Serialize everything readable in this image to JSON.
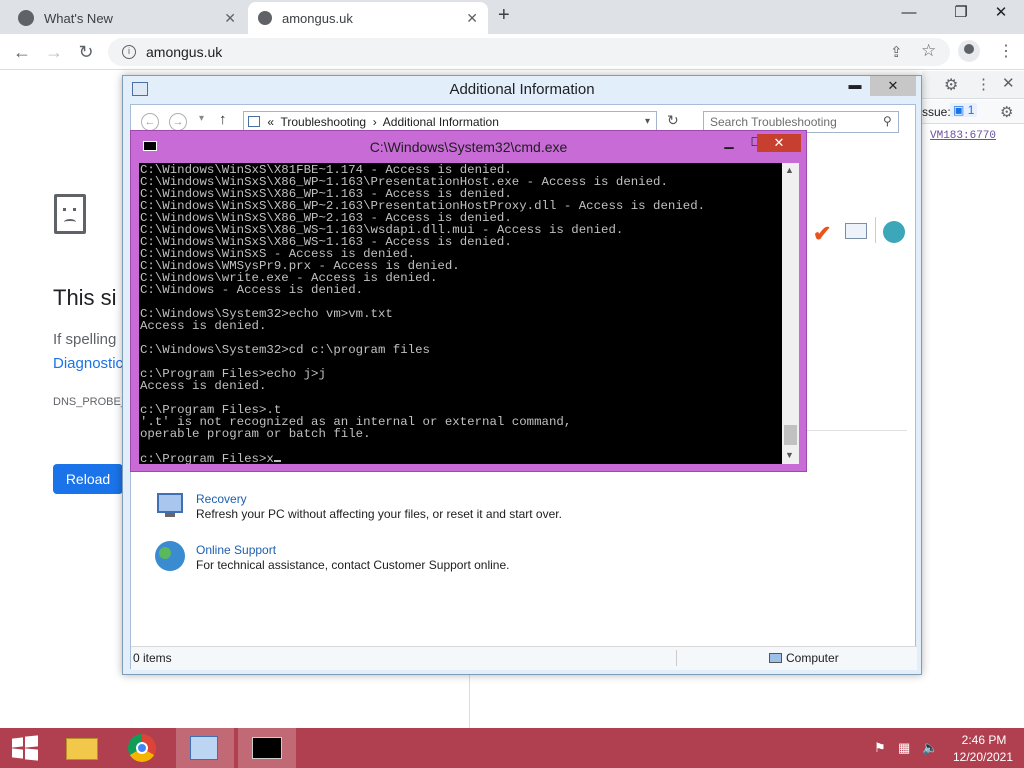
{
  "browser": {
    "tabs": [
      {
        "label": "What's New"
      },
      {
        "label": "amongus.uk"
      }
    ],
    "url": "amongus.uk",
    "error": {
      "title": "This si",
      "line1": "If spelling",
      "link": "Diagnostic",
      "code": "DNS_PROBE_",
      "reload": "Reload"
    },
    "devtools": {
      "issues_label": "ssue:",
      "issues_count": "1",
      "link": "VM183:6770"
    }
  },
  "explorer": {
    "title": "Additional Information",
    "breadcrumb": {
      "prefix": "«",
      "crumb1": "Troubleshooting",
      "sep": "›",
      "crumb2": "Additional Information"
    },
    "search_placeholder": "Search Troubleshooting",
    "items": [
      {
        "title": "Recovery",
        "desc": "Refresh your PC without affecting your files, or reset it and start over."
      },
      {
        "title": "Online Support",
        "desc": "For technical assistance, contact Customer Support online."
      }
    ],
    "status_left": "0 items",
    "status_right": "Computer"
  },
  "cmd": {
    "title": "C:\\Windows\\System32\\cmd.exe",
    "lines": [
      "C:\\Windows\\WinSxS\\X81FBE~1.174 - Access is denied.",
      "C:\\Windows\\WinSxS\\X86_WP~1.163\\PresentationHost.exe - Access is denied.",
      "C:\\Windows\\WinSxS\\X86_WP~1.163 - Access is denied.",
      "C:\\Windows\\WinSxS\\X86_WP~2.163\\PresentationHostProxy.dll - Access is denied.",
      "C:\\Windows\\WinSxS\\X86_WP~2.163 - Access is denied.",
      "C:\\Windows\\WinSxS\\X86_WS~1.163\\wsdapi.dll.mui - Access is denied.",
      "C:\\Windows\\WinSxS\\X86_WS~1.163 - Access is denied.",
      "C:\\Windows\\WinSxS - Access is denied.",
      "C:\\Windows\\WMSysPr9.prx - Access is denied.",
      "C:\\Windows\\write.exe - Access is denied.",
      "C:\\Windows - Access is denied.",
      "",
      "C:\\Windows\\System32>echo vm>vm.txt",
      "Access is denied.",
      "",
      "C:\\Windows\\System32>cd c:\\program files",
      "",
      "c:\\Program Files>echo j>j",
      "Access is denied.",
      "",
      "c:\\Program Files>.t",
      "'.t' is not recognized as an internal or external command,",
      "operable program or batch file.",
      ""
    ],
    "prompt": "c:\\Program Files>x"
  },
  "taskbar": {
    "time": "2:46 PM",
    "date": "12/20/2021"
  }
}
